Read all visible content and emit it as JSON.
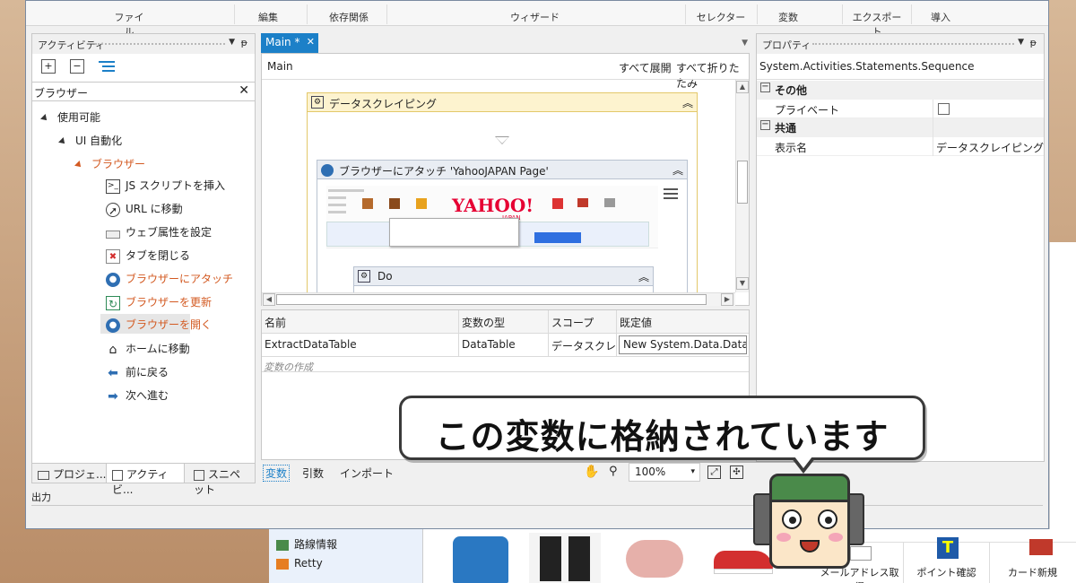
{
  "ribbon": {
    "tabs": [
      "ファイル",
      "編集",
      "依存関係",
      "ウィザード",
      "セレクター",
      "変数",
      "エクスポート",
      "導入"
    ]
  },
  "activities": {
    "title": "アクティビティ",
    "search_value": "ブラウザー",
    "tree": {
      "available": "使用可能",
      "ui_automation": "UI 自動化",
      "browser": "ブラウザー",
      "items": [
        "JS スクリプトを挿入",
        "URL に移動",
        "ウェブ属性を設定",
        "タブを閉じる",
        "ブラウザーにアタッチ",
        "ブラウザーを更新",
        "ブラウザーを開く",
        "ホームに移動",
        "前に戻る",
        "次へ進む"
      ]
    },
    "bottom_tabs": [
      "プロジェ...",
      "アクティビ...",
      "スニペット"
    ]
  },
  "output_label": "出力",
  "designer": {
    "tab_label": "Main *",
    "breadcrumb": "Main",
    "expand_all": "すべて展開",
    "collapse_all": "すべて折りたたみ",
    "sequence_title": "データスクレイピング",
    "attach_title": "ブラウザーにアタッチ 'YahooJAPAN Page'",
    "do_title": "Do",
    "yahoo_logo": "YAHOO!",
    "yahoo_sub": "JAPAN"
  },
  "variables": {
    "headers": [
      "名前",
      "変数の型",
      "スコープ",
      "既定値"
    ],
    "rows": [
      {
        "name": "ExtractDataTable",
        "type": "DataTable",
        "scope": "データスクレイピ",
        "default": "New System.Data.DataTa"
      }
    ],
    "create_hint": "変数の作成",
    "bottom_tabs": [
      "変数",
      "引数",
      "インポート"
    ],
    "zoom": "100%"
  },
  "properties": {
    "title": "プロパティ",
    "type_name": "System.Activities.Statements.Sequence",
    "groups": [
      {
        "name": "その他",
        "rows": [
          {
            "label": "プライベート",
            "value": ""
          }
        ]
      },
      {
        "name": "共通",
        "rows": [
          {
            "label": "表示名",
            "value": "データスクレイピング"
          }
        ]
      }
    ]
  },
  "background_page": {
    "links": [
      "路線情報",
      "Retty"
    ],
    "buttons": [
      "メールアドレス取得",
      "ポイント確認",
      "カード新規"
    ]
  },
  "callout": {
    "text": "この変数に格納されています"
  },
  "colors": {
    "accent": "#1c80c8",
    "browser_red": "#d35a22",
    "sequence_yellow": "#fdf3cf"
  }
}
